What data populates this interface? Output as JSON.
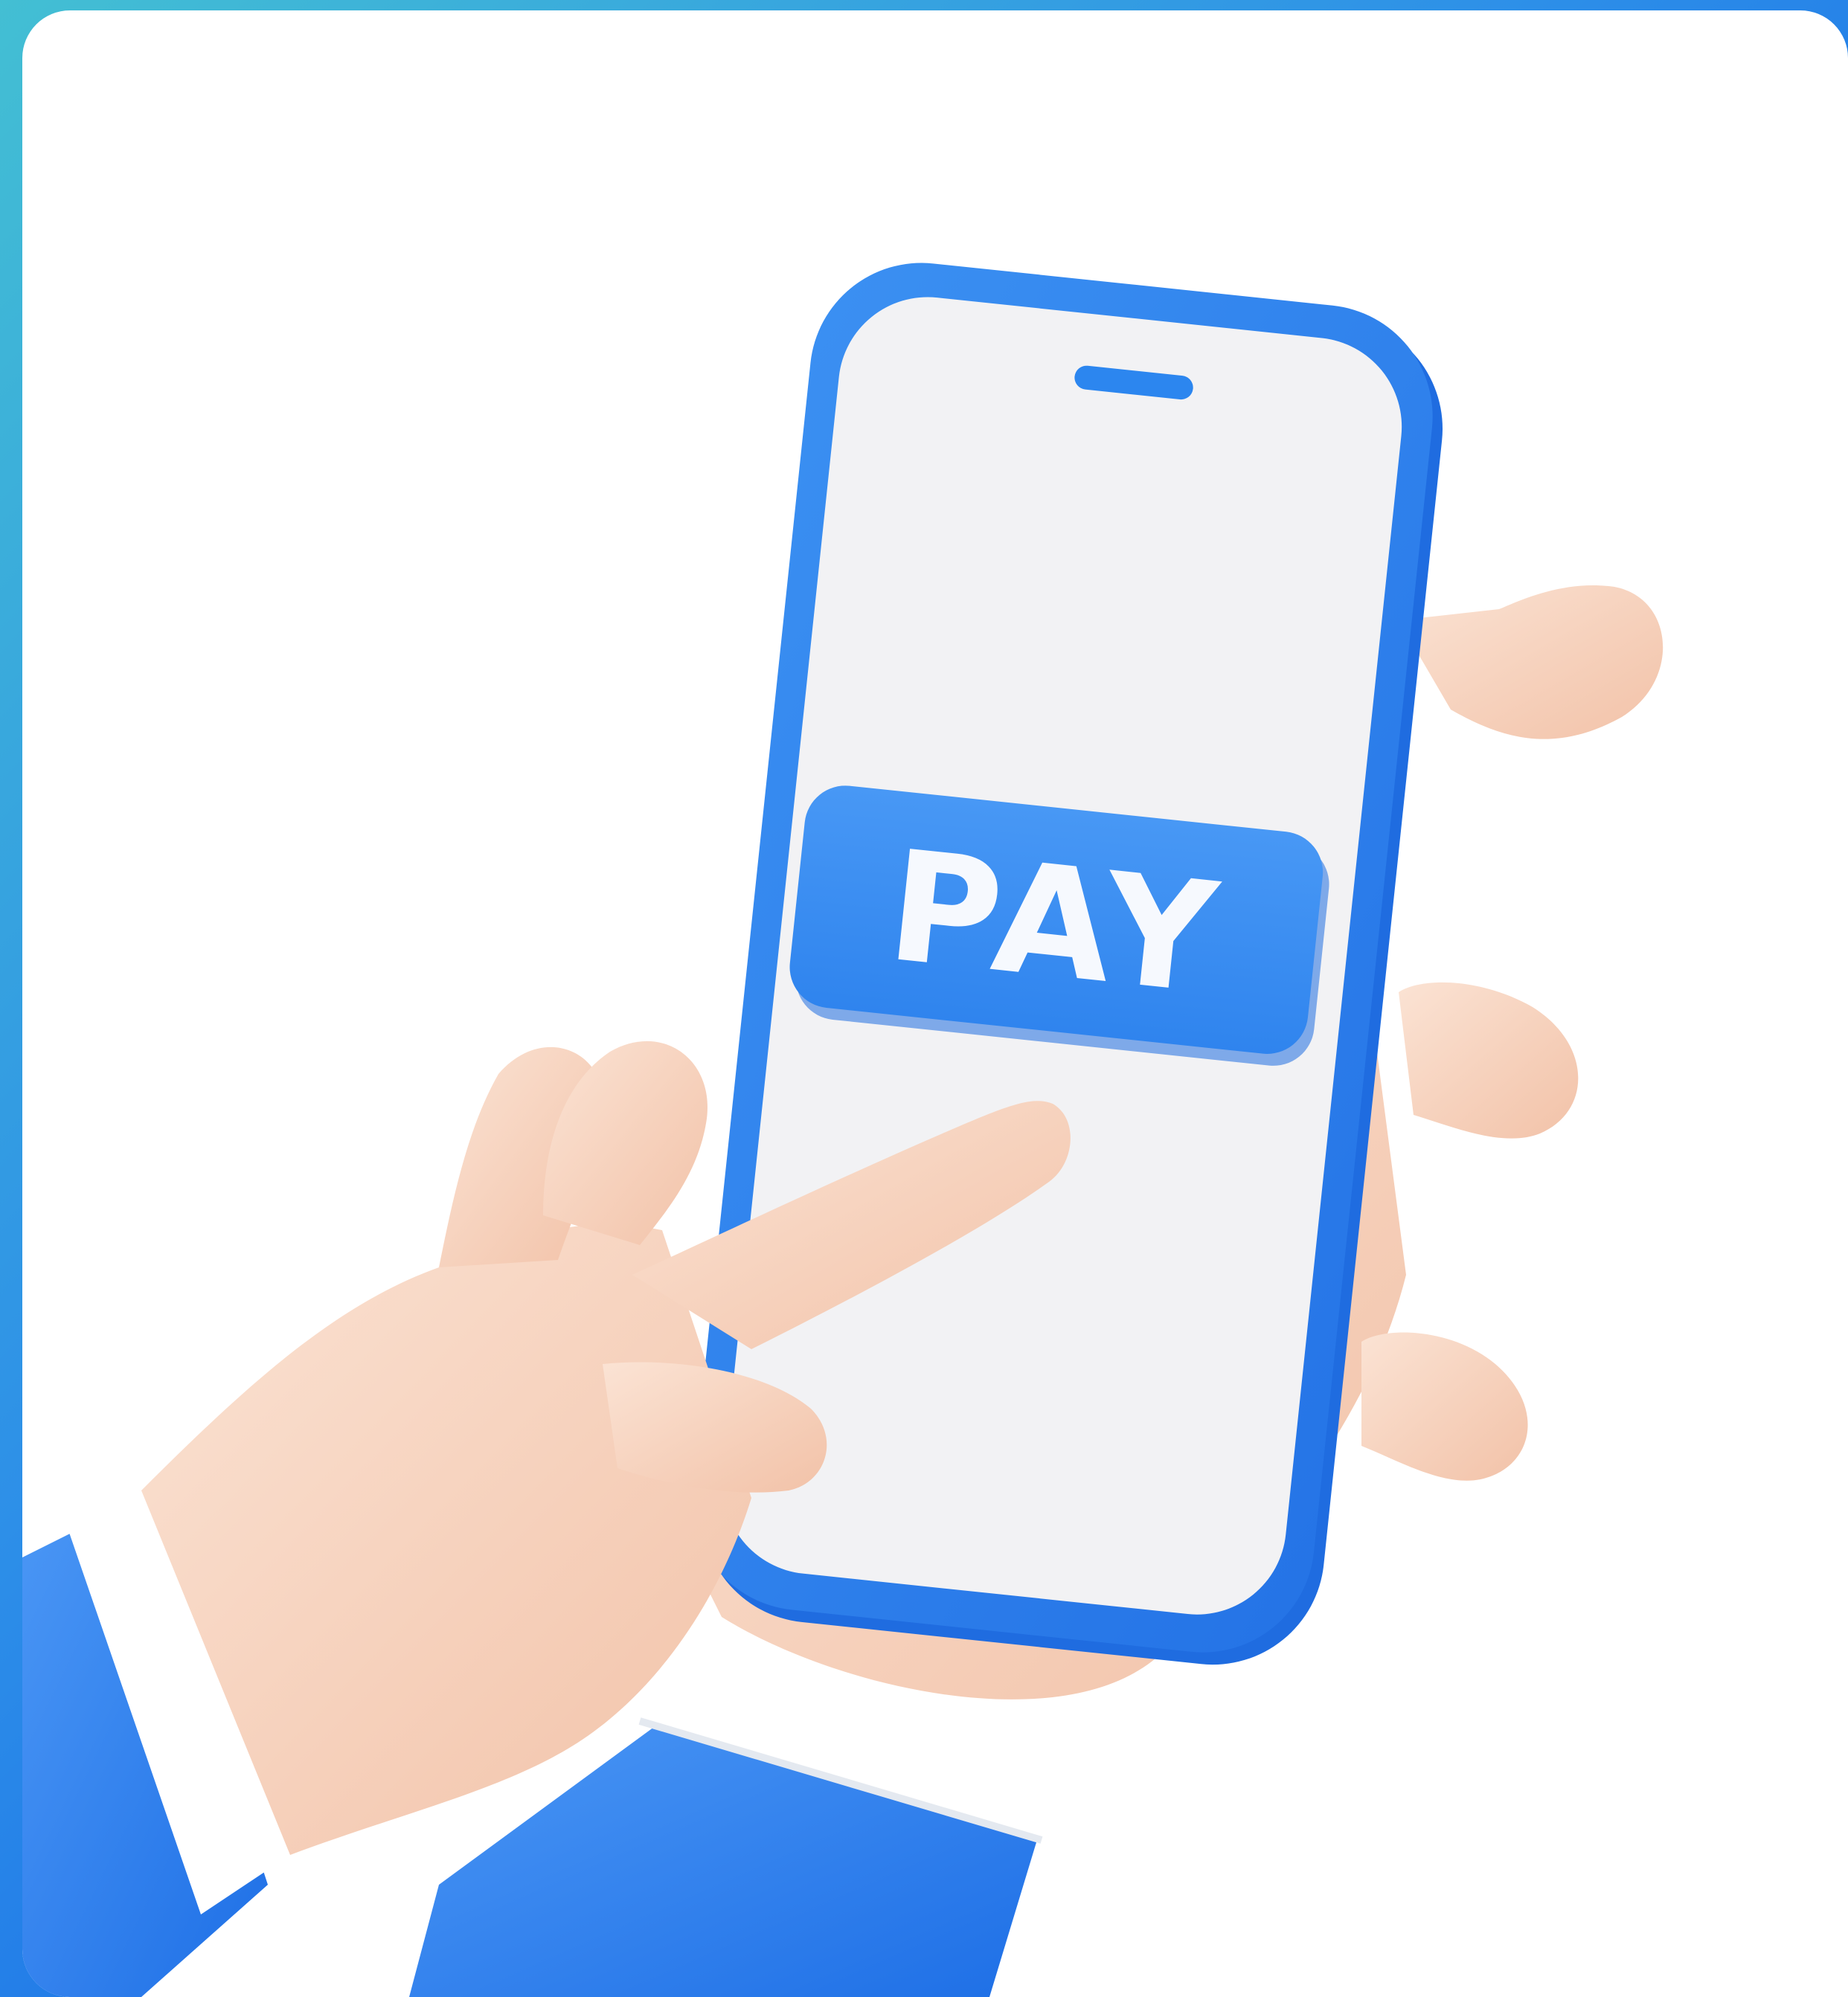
{
  "illustration": {
    "pay_button_label": "PAY"
  },
  "colors": {
    "background_gradient_start": "#43bfd3",
    "background_gradient_end": "#1667e8",
    "card": "#ffffff",
    "phone_frame": "#2f86ec",
    "phone_screen": "#f2f2f4",
    "pay_button": "#3a8ef0",
    "skin": "#f7d2bd",
    "sleeve": "#2f80ee",
    "cuff": "#ffffff"
  },
  "icons": {
    "speaker": "speaker-slot-icon"
  }
}
